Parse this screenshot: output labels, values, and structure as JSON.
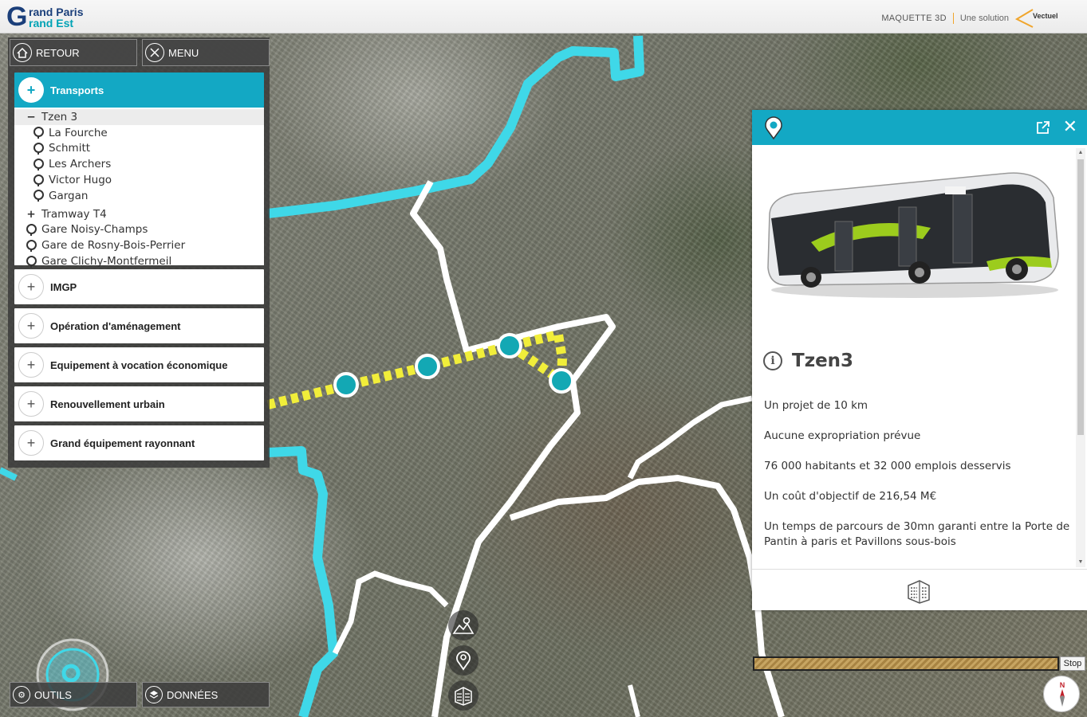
{
  "header": {
    "logo_letter": "G",
    "logo_line1": "rand Paris",
    "logo_line2": "rand Est",
    "maquette": "MAQUETTE 3D",
    "solution": "Une solution",
    "vendor": "Vectuel"
  },
  "nav": {
    "retour_label": "RETOUR",
    "menu_label": "MENU"
  },
  "categories": {
    "transports": {
      "label": "Transports",
      "expanded": true
    },
    "tree": [
      {
        "label": "Tzen 3",
        "type": "group-open"
      },
      {
        "label": "La Fourche",
        "type": "station"
      },
      {
        "label": "Schmitt",
        "type": "station"
      },
      {
        "label": "Les Archers",
        "type": "station"
      },
      {
        "label": "Victor Hugo",
        "type": "station"
      },
      {
        "label": "Gargan",
        "type": "station"
      },
      {
        "label": "Tramway T4",
        "type": "group-closed"
      },
      {
        "label": "Gare Noisy-Champs",
        "type": "station"
      },
      {
        "label": "Gare de Rosny-Bois-Perrier",
        "type": "station"
      },
      {
        "label": "Gare Clichy-Montfermeil",
        "type": "station"
      }
    ],
    "others": [
      {
        "label": "IMGP"
      },
      {
        "label": "Opération d'aménagement"
      },
      {
        "label": "Equipement à vocation économique"
      },
      {
        "label": "Renouvellement urbain"
      },
      {
        "label": "Grand équipement rayonnant"
      }
    ]
  },
  "info_panel": {
    "title": "Tzen3",
    "info_icon": "i",
    "lines": [
      "Un projet de 10 km",
      "Aucune expropriation prévue",
      "76 000 habitants et 32 000 emplois desservis",
      "Un coût d'objectif de 216,54 M€",
      "Un temps de parcours de 30mn garanti entre la Porte de Pantin à paris et Pavillons sous-bois"
    ],
    "header_icon": "location-pin-icon",
    "footer_icon": "building-icon"
  },
  "bottom": {
    "outils_label": "OUTILS",
    "donnees_label": "DONNÉES",
    "stop_label": "Stop",
    "compass_label": "N"
  },
  "colors": {
    "accent": "#13a8c4",
    "boundary": "#3fd8e8",
    "route": "#ffffff",
    "line_dash": "#f1ee3a",
    "station": "#13a8b4"
  }
}
